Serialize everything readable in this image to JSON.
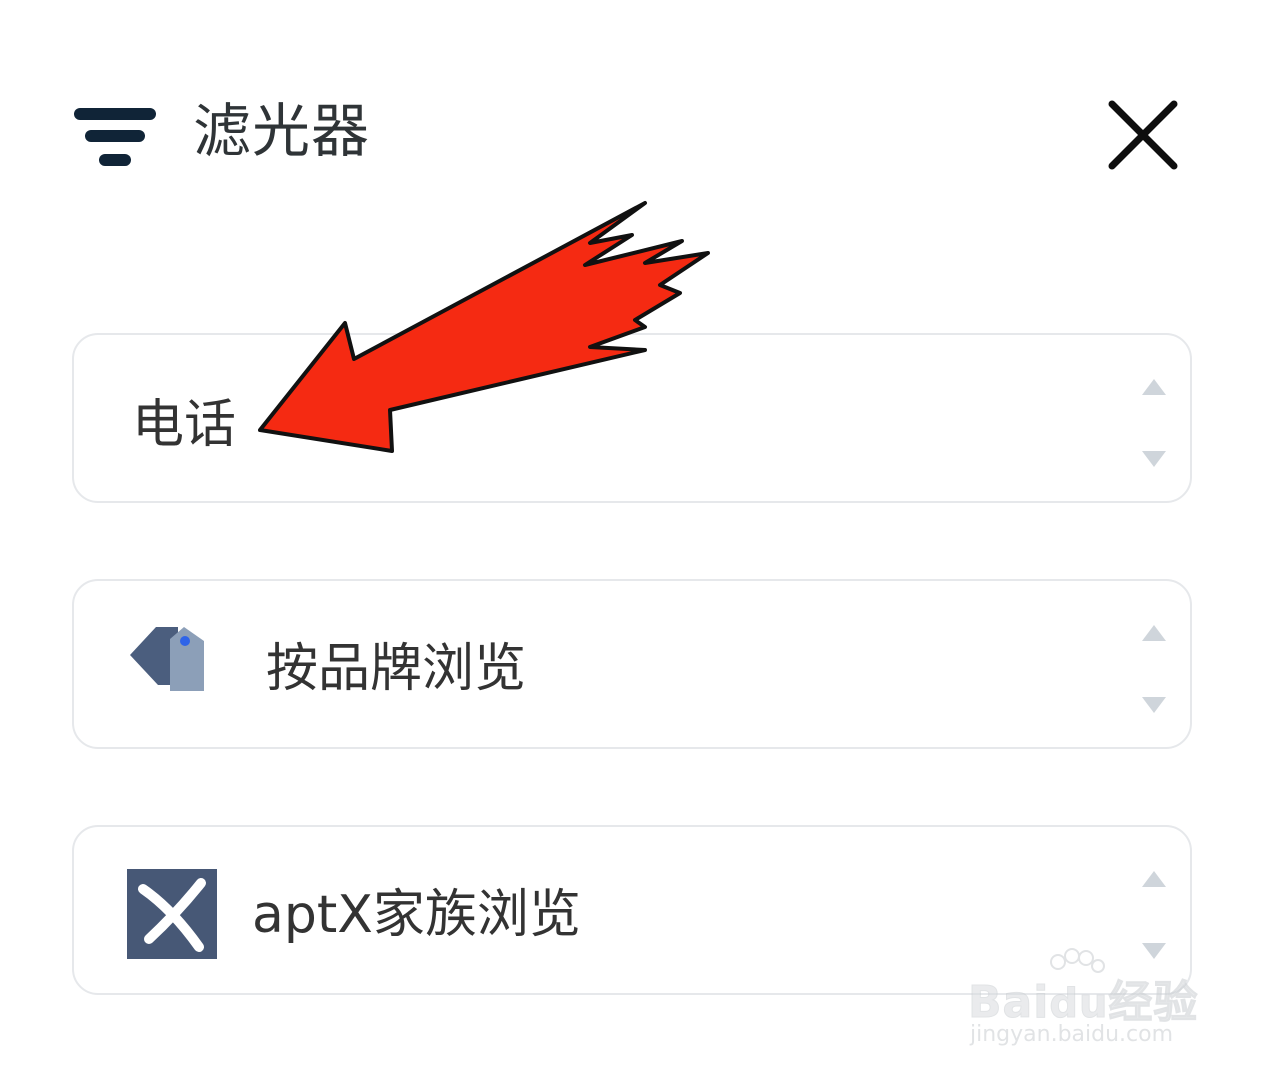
{
  "header": {
    "title": "滤光器",
    "filter_icon": "filter-lines-icon",
    "close_icon": "close-icon"
  },
  "filters": [
    {
      "label": "电话",
      "icon": null
    },
    {
      "label": "按品牌浏览",
      "icon": "brand-tag-icon"
    },
    {
      "label": "aptX家族浏览",
      "icon": "aptx-logo-icon"
    }
  ],
  "annotation": {
    "icon": "red-arrow-pointer",
    "color": "#f52a12"
  },
  "watermark": {
    "brand": "Bai",
    "brand_cn": "经验",
    "url": "jingyan.baidu.com"
  },
  "colors": {
    "title_text": "#2f3437",
    "card_border": "#e6e8eb",
    "sort_arrow": "#cfd5db",
    "icon_slate": "#475876"
  }
}
